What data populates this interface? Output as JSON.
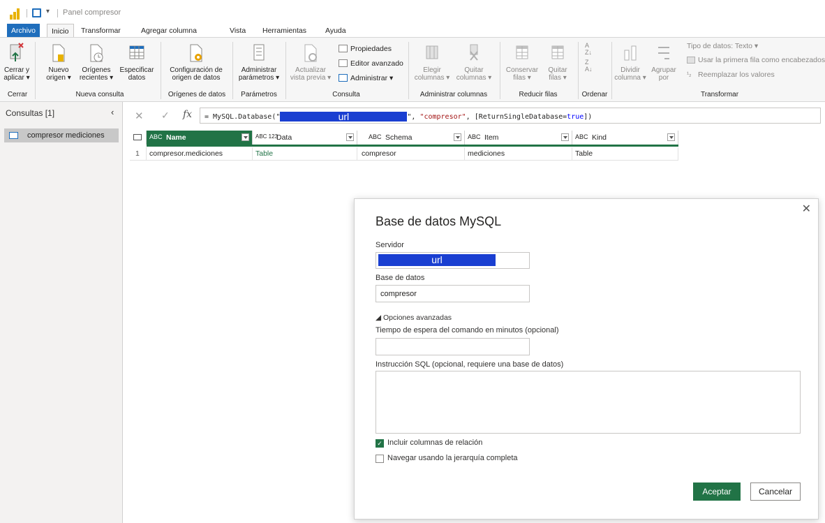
{
  "window": {
    "title": "Panel compresor"
  },
  "tabs": [
    "Archivo",
    "Inicio",
    "Transformar",
    "Agregar columna",
    "Vista",
    "Herramientas",
    "Ayuda"
  ],
  "ribbon": {
    "close_apply": [
      "Cerrar y",
      "aplicar ▾"
    ],
    "new_source": [
      "Nuevo",
      "origen ▾"
    ],
    "recent_sources": [
      "Orígenes",
      "recientes ▾"
    ],
    "enter_data": [
      "Especificar",
      "datos"
    ],
    "ds_settings": [
      "Configuración de",
      "origen de datos"
    ],
    "manage_params": [
      "Administrar",
      "parámetros ▾"
    ],
    "refresh_preview": [
      "Actualizar",
      "vista previa ▾"
    ],
    "properties": "Propiedades",
    "adv_editor": "Editor avanzado",
    "manage": "Administrar ▾",
    "choose_cols": [
      "Elegir",
      "columnas ▾"
    ],
    "remove_cols": [
      "Quitar",
      "columnas ▾"
    ],
    "keep_rows": [
      "Conservar",
      "filas ▾"
    ],
    "remove_rows": [
      "Quitar",
      "filas ▾"
    ],
    "split_col": [
      "Dividir",
      "columna ▾"
    ],
    "group_by": [
      "Agrupar",
      "por"
    ],
    "data_type": "Tipo de datos: Texto ▾",
    "first_row_headers": "Usar la primera fila como encabezados",
    "replace_values": "Reemplazar los valores",
    "groups": {
      "close": "Cerrar",
      "new_query": "Nueva consulta",
      "data_sources": "Orígenes de datos",
      "parameters": "Parámetros",
      "query": "Consulta",
      "manage_columns": "Administrar columnas",
      "reduce_rows": "Reducir filas",
      "sort": "Ordenar",
      "transform": "Transformar"
    }
  },
  "queries": {
    "header": "Consultas [1]",
    "items": [
      "compresor mediciones"
    ]
  },
  "formula": {
    "prefix": "= MySQL.Database(\"",
    "redacted": "url",
    "suffix_str": "\", ",
    "db_literal": "\"compresor\"",
    "mid": ", [ReturnSingleDatabase=",
    "bool": "true",
    "end": "])"
  },
  "table": {
    "columns": [
      {
        "type": "ABC",
        "name": "Name"
      },
      {
        "type": "ABC 123",
        "name": "Data"
      },
      {
        "type": "ABC",
        "name": "Schema"
      },
      {
        "type": "ABC",
        "name": "Item"
      },
      {
        "type": "ABC",
        "name": "Kind"
      }
    ],
    "rows": [
      {
        "n": "1",
        "name": "compresor.mediciones",
        "data": "Table",
        "schema": "compresor",
        "item": "mediciones",
        "kind": "Table"
      }
    ]
  },
  "dialog": {
    "title": "Base de datos MySQL",
    "server_label": "Servidor",
    "server_value": "url",
    "db_label": "Base de datos",
    "db_value": "compresor",
    "advanced": "◢ Opciones avanzadas",
    "timeout_label": "Tiempo de espera del comando en minutos (opcional)",
    "timeout_value": "",
    "sql_label": "Instrucción SQL (opcional, requiere una base de datos)",
    "sql_value": "",
    "include_rel": "Incluir columnas de relación",
    "include_rel_checked": true,
    "nav_full": "Navegar usando la jerarquía completa",
    "nav_full_checked": false,
    "ok": "Aceptar",
    "cancel": "Cancelar"
  },
  "colors": {
    "accent": "#217346",
    "file_tab": "#1f6ebc",
    "redaction": "#1a3fd1",
    "logo": "#e8b200"
  }
}
